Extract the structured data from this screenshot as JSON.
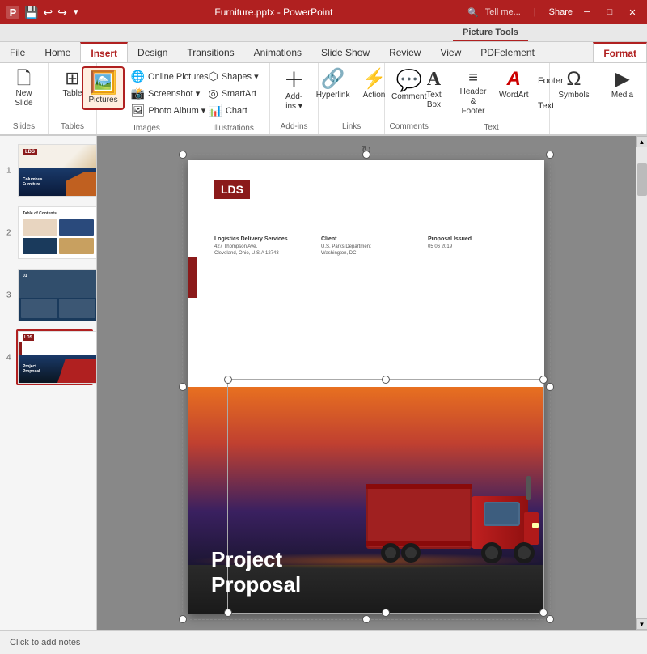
{
  "titleBar": {
    "saveIcon": "💾",
    "undoIcon": "↩",
    "redoIcon": "↪",
    "customizeIcon": "▼",
    "title": "Furniture.pptx - PowerPoint",
    "pictureToolsLabel": "Picture Tools",
    "minimizeIcon": "─",
    "maximizeIcon": "□",
    "closeIcon": "✕"
  },
  "ribbon": {
    "tabs": [
      "File",
      "Home",
      "Insert",
      "Design",
      "Transitions",
      "Animations",
      "Slide Show",
      "Review",
      "View",
      "PDFelement"
    ],
    "activeTab": "Insert",
    "formatTab": "Format",
    "groups": {
      "slides": {
        "label": "Slides",
        "buttons": [
          {
            "icon": "🗋",
            "label": "New\nSlide"
          }
        ]
      },
      "tables": {
        "label": "Tables",
        "buttons": [
          {
            "icon": "⊞",
            "label": "Table"
          }
        ]
      },
      "images": {
        "label": "Images",
        "buttons": [
          {
            "icon": "🖼",
            "label": "Pictures",
            "active": true
          },
          {
            "subItems": [
              "🌐 Online Pictures",
              "📸 Screenshot ▾",
              "🖼 Photo Album ▾"
            ]
          }
        ]
      },
      "illustrations": {
        "label": "Illustrations",
        "buttons": [
          {
            "subItems": [
              "⬡ Shapes ▾",
              "◎ SmartArt",
              "📊 Chart"
            ]
          }
        ]
      },
      "addins": {
        "label": "Add-ins",
        "buttons": [
          {
            "icon": "＋",
            "label": "Add-\nins ▾"
          }
        ]
      },
      "links": {
        "label": "Links",
        "buttons": [
          {
            "icon": "🔗",
            "label": "Hyperlink"
          },
          {
            "icon": "⚡",
            "label": "Action"
          }
        ]
      },
      "comments": {
        "label": "Comments",
        "buttons": [
          {
            "icon": "💬",
            "label": "Comment"
          }
        ]
      },
      "text": {
        "label": "Text",
        "buttons": [
          {
            "icon": "A",
            "label": "Text\nBox"
          },
          {
            "icon": "≡",
            "label": "Header\n& Footer"
          },
          {
            "icon": "A",
            "label": "WordArt"
          },
          {
            "subItems": [
              "Footer",
              "Text"
            ]
          }
        ]
      },
      "symbols": {
        "label": "",
        "buttons": [
          {
            "icon": "Ω",
            "label": "Symbols"
          }
        ]
      },
      "media": {
        "label": "",
        "buttons": [
          {
            "icon": "▶",
            "label": "Media"
          }
        ]
      }
    }
  },
  "slides": [
    {
      "num": "1",
      "type": "cover-chair"
    },
    {
      "num": "2",
      "type": "toc"
    },
    {
      "num": "3",
      "type": "dark-blue"
    },
    {
      "num": "4",
      "type": "proposal",
      "active": true
    }
  ],
  "mainSlide": {
    "logoText": "LDS",
    "companyLabel": "Logistics Delivery Services",
    "companyAddress": "427 Thompson Ave.\nCleveland, Ohio, U.S.A 12743",
    "clientLabel": "Client",
    "clientName": "U.S. Parks Department\nWashington, DC",
    "proposalIssuedLabel": "Proposal Issued",
    "proposalDate": "05  06  2019",
    "proposalTitle": "Project\nProposal",
    "rotateTooltip": "↻"
  },
  "statusBar": {
    "text": "Click to add notes"
  },
  "search": {
    "placeholder": "Tell me...",
    "icon": "🔍"
  },
  "shareBtn": "Share"
}
